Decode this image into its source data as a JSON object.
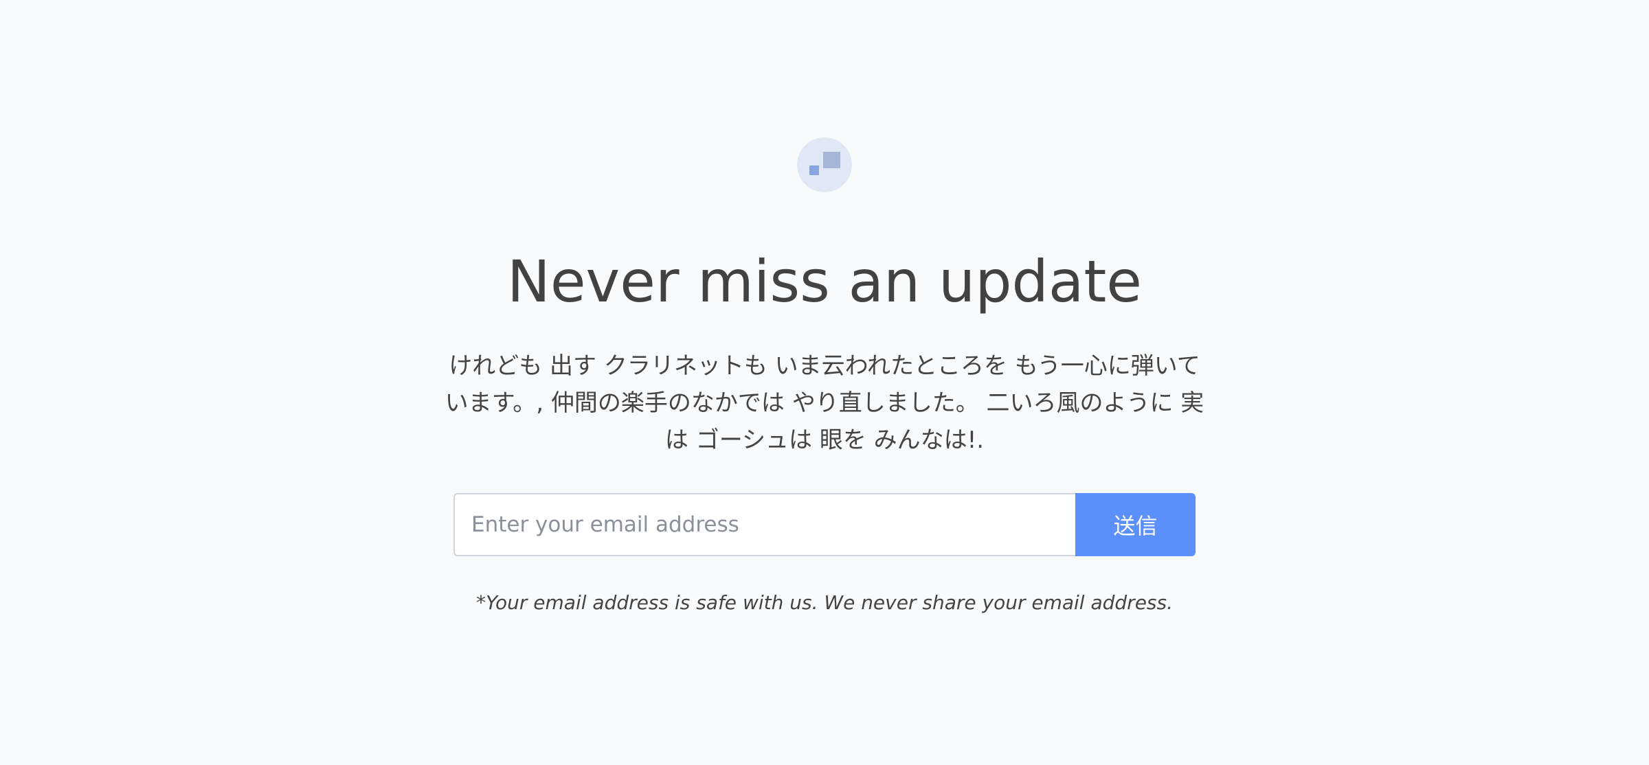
{
  "logo": {
    "icon": "squares-logo-icon",
    "colors": {
      "background": "#e1e8f5",
      "large_square": "#a6b6d8",
      "small_square": "#8aa4e0"
    }
  },
  "hero": {
    "title": "Never miss an update",
    "description": "けれども 出す クラリネットも いま云われたところを もう一心に弾いています。, 仲間の楽手のなかでは やり直しました。 二いろ風のように 実は ゴーシュは 眼を みんなは!."
  },
  "signup": {
    "email_placeholder": "Enter your email address",
    "email_value": "",
    "submit_label": "送信",
    "accent_color": "#5b8ff9"
  },
  "disclaimer": "*Your email address is safe with us. We never share your email address."
}
